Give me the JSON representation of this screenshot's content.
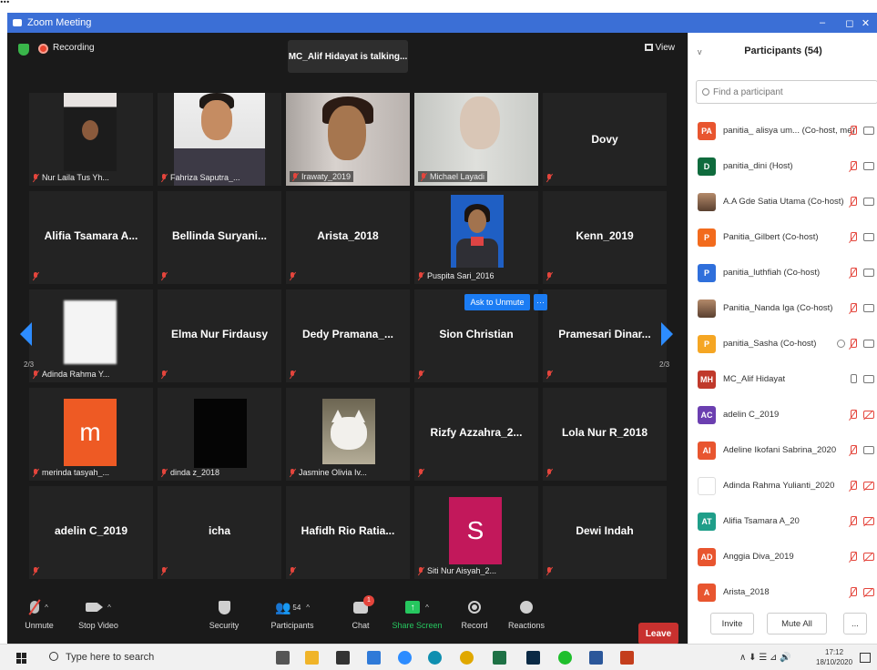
{
  "window": {
    "title": "Zoom Meeting",
    "controls": [
      "–",
      "◻",
      "✕"
    ]
  },
  "meeting": {
    "recording_label": "Recording",
    "talking_banner": "MC_Alif Hidayat is talking...",
    "view_label": "View",
    "page_left": "2/3",
    "page_right": "2/3",
    "ask_unmute": "Ask to Unmute",
    "ask_more": "···",
    "tiles": [
      {
        "name": "Nur Laila Tus Yh...",
        "mode": "foot"
      },
      {
        "name": "Fahriza Saputra_...",
        "mode": "foot"
      },
      {
        "name": "Irawaty_2019",
        "mode": "foot"
      },
      {
        "name": "Michael Layadi",
        "mode": "foot"
      },
      {
        "name": "Dovy",
        "mode": "center"
      },
      {
        "name": "Alifia Tsamara A...",
        "mode": "center"
      },
      {
        "name": "Bellinda  Suryani...",
        "mode": "center"
      },
      {
        "name": "Arista_2018",
        "mode": "center"
      },
      {
        "name": "Puspita Sari_2016",
        "mode": "foot"
      },
      {
        "name": "Kenn_2019",
        "mode": "center"
      },
      {
        "name": "Adinda Rahma Y...",
        "mode": "foot"
      },
      {
        "name": "Elma Nur Firdausy",
        "mode": "center"
      },
      {
        "name": "Dedy  Pramana_...",
        "mode": "center"
      },
      {
        "name": "Sion Christian",
        "mode": "center"
      },
      {
        "name": "Pramesari  Dinar...",
        "mode": "center"
      },
      {
        "name": "merinda tasyah_...",
        "mode": "foot",
        "avatar": "m"
      },
      {
        "name": "dinda z_2018",
        "mode": "foot"
      },
      {
        "name": "Jasmine Olivia Iv...",
        "mode": "foot"
      },
      {
        "name": "Rizfy  Azzahra_2...",
        "mode": "center"
      },
      {
        "name": "Lola Nur R_2018",
        "mode": "center"
      },
      {
        "name": "adelin C_2019",
        "mode": "center"
      },
      {
        "name": "icha",
        "mode": "center"
      },
      {
        "name": "Hafidh  Rio  Ratia...",
        "mode": "center"
      },
      {
        "name": "Siti Nur Aisyah_2...",
        "mode": "foot",
        "avatar": "S"
      },
      {
        "name": "Dewi Indah",
        "mode": "center"
      }
    ]
  },
  "toolbar": {
    "unmute": "Unmute",
    "stop_video": "Stop Video",
    "security": "Security",
    "participants": "Participants",
    "participants_count": "54",
    "chat": "Chat",
    "chat_badge": "1",
    "share_screen": "Share Screen",
    "record": "Record",
    "reactions": "Reactions",
    "leave": "Leave"
  },
  "panel": {
    "title": "Participants (54)",
    "search_placeholder": "Find a participant",
    "participants": [
      {
        "initials": "PA",
        "name": "panitia_ alisya um... (Co-host, me)",
        "color": "#e8552f",
        "mic": "off",
        "cam": "on"
      },
      {
        "initials": "D",
        "name": "panitia_dini (Host)",
        "color": "#0f6b3d",
        "mic": "off",
        "cam": "on"
      },
      {
        "initials": "",
        "name": "A.A Gde Satia Utama (Co-host)",
        "color": "photo",
        "mic": "off",
        "cam": "on"
      },
      {
        "initials": "P",
        "name": "Panitia_Gilbert (Co-host)",
        "color": "#f26b1d",
        "mic": "off",
        "cam": "on"
      },
      {
        "initials": "P",
        "name": "panitia_luthfiah (Co-host)",
        "color": "#2f6fdb",
        "mic": "off",
        "cam": "on"
      },
      {
        "initials": "",
        "name": "Panitia_Nanda Iga (Co-host)",
        "color": "photo",
        "mic": "off",
        "cam": "on"
      },
      {
        "initials": "P",
        "name": "panitia_Sasha (Co-host)",
        "color": "#f5a623",
        "mic": "off",
        "cam": "on",
        "spotlight": true
      },
      {
        "initials": "MH",
        "name": "MC_Alif Hidayat",
        "color": "#c0392b",
        "mic": "on",
        "cam": "on"
      },
      {
        "initials": "AC",
        "name": "adelin C_2019",
        "color": "#6b3fb0",
        "mic": "off",
        "cam": "off"
      },
      {
        "initials": "AI",
        "name": "Adeline Ikofani Sabrina_2020",
        "color": "#e8552f",
        "mic": "off",
        "cam": "on"
      },
      {
        "initials": "",
        "name": "Adinda Rahma Yulianti_2020",
        "color": "empty",
        "mic": "off",
        "cam": "off"
      },
      {
        "initials": "AT",
        "name": "Alifia Tsamara A_20",
        "color": "#1f9e89",
        "mic": "off",
        "cam": "off"
      },
      {
        "initials": "AD",
        "name": "Anggia Diva_2019",
        "color": "#e8552f",
        "mic": "off",
        "cam": "off"
      },
      {
        "initials": "A",
        "name": "Arista_2018",
        "color": "#e8552f",
        "mic": "off",
        "cam": "off"
      }
    ],
    "invite": "Invite",
    "mute_all": "Mute All",
    "more": "..."
  },
  "taskbar": {
    "search_placeholder": "Type here to search",
    "time": "17:12",
    "date": "18/10/2020",
    "tray_icons": "∧  ⬇  ☰  ⊿  🔊"
  },
  "top_strip_text": "..."
}
